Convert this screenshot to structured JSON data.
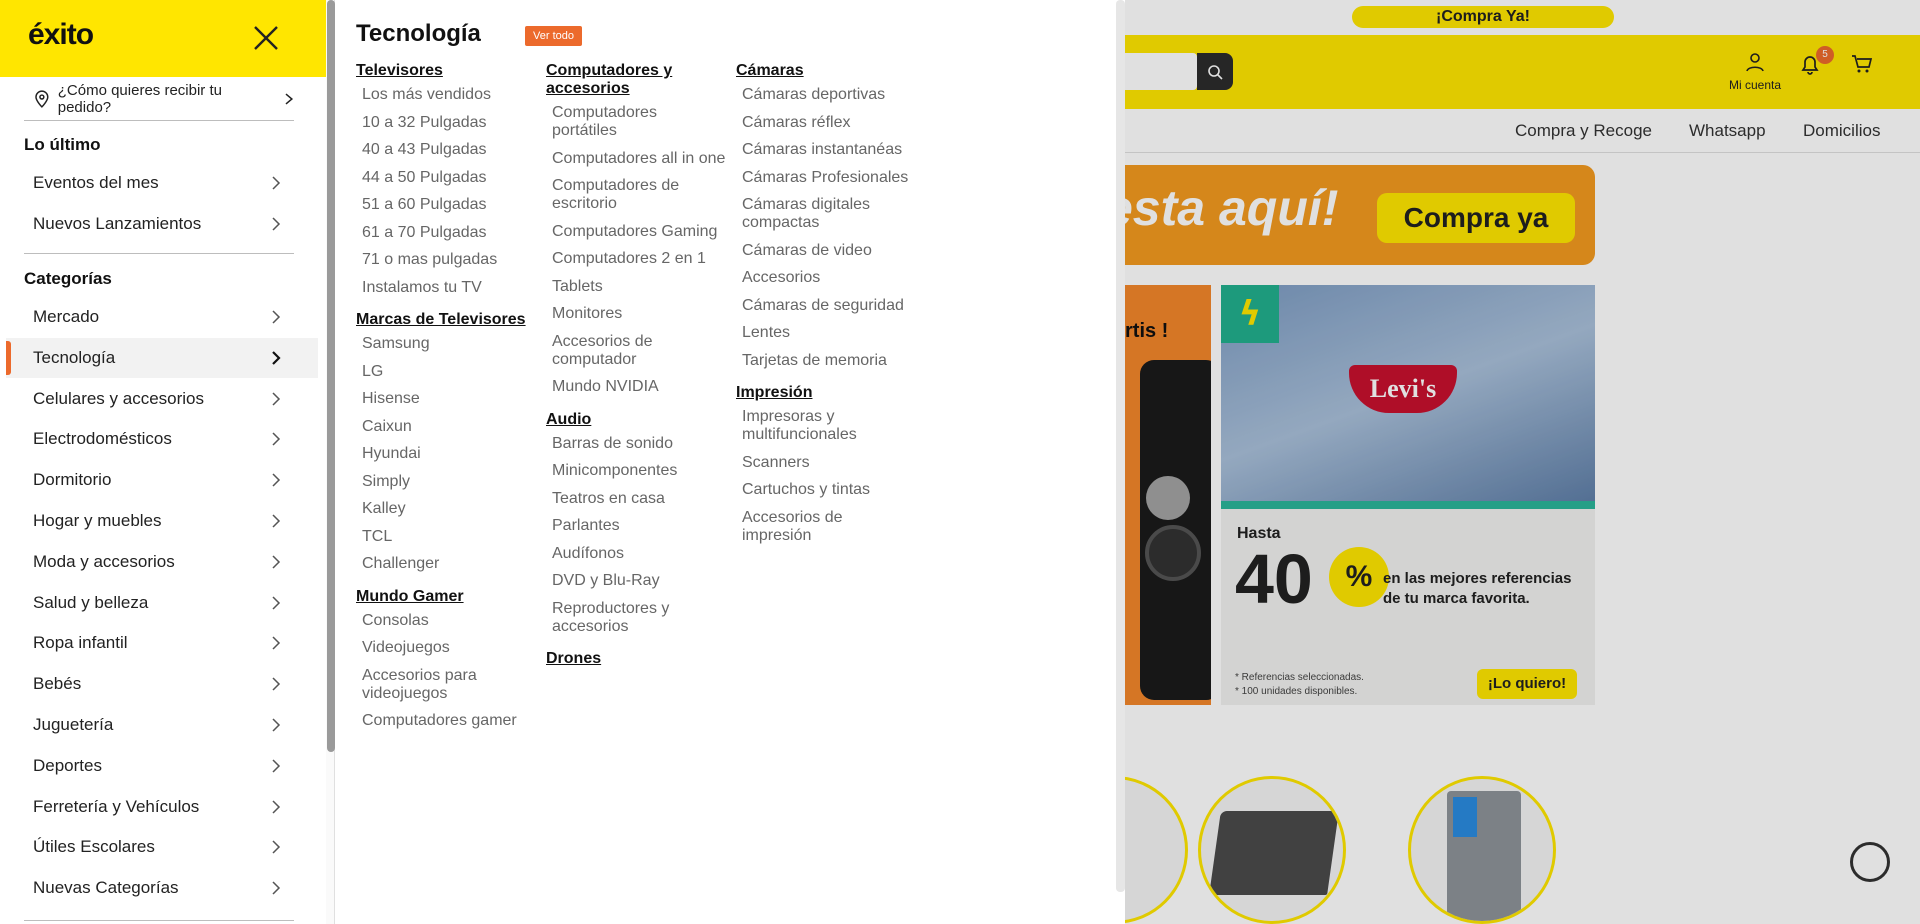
{
  "background": {
    "promo_pill": "¡Compra Ya!",
    "account_label": "Mi cuenta",
    "notif_count": "5",
    "subnav": [
      "Compra y Recoge",
      "Whatsapp",
      "Domicilios"
    ],
    "banner_text": "esta aquí!",
    "banner_button": "Compra ya",
    "phone_card_text": "rtis !",
    "levis_logo": "Levi's",
    "levis_hasta": "Hasta",
    "levis_number": "40",
    "levis_percent": "%",
    "levis_copy": "en las mejores referencias de tu marca favorita.",
    "levis_fine_1": "* Referencias seleccionadas.",
    "levis_fine_2": "* 100 unidades disponibles.",
    "levis_button": "¡Lo quiero!"
  },
  "sidebar": {
    "logo": "éxito",
    "delivery_prompt": "¿Cómo quieres recibir tu pedido?",
    "section_latest": "Lo último",
    "latest_items": [
      {
        "label": "Eventos del mes"
      },
      {
        "label": "Nuevos Lanzamientos"
      }
    ],
    "section_categories": "Categorías",
    "categories": [
      {
        "label": "Mercado"
      },
      {
        "label": "Tecnología",
        "active": true
      },
      {
        "label": "Celulares y accesorios"
      },
      {
        "label": "Electrodomésticos"
      },
      {
        "label": "Dormitorio"
      },
      {
        "label": "Hogar y muebles"
      },
      {
        "label": "Moda y accesorios"
      },
      {
        "label": "Salud y belleza"
      },
      {
        "label": "Ropa infantil"
      },
      {
        "label": "Bebés"
      },
      {
        "label": "Juguetería"
      },
      {
        "label": "Deportes"
      },
      {
        "label": "Ferretería y Vehículos"
      },
      {
        "label": "Útiles Escolares"
      },
      {
        "label": "Nuevas Categorías"
      }
    ]
  },
  "panel": {
    "title": "Tecnología",
    "ver_todo": "Ver todo",
    "columns": [
      [
        {
          "title": "Televisores",
          "links": [
            "Los más vendidos",
            "10 a 32 Pulgadas",
            "40 a 43 Pulgadas",
            "44 a 50 Pulgadas",
            "51 a 60 Pulgadas",
            "61 a 70 Pulgadas",
            "71 o mas pulgadas",
            "Instalamos tu TV"
          ]
        },
        {
          "title": "Marcas de Televisores",
          "links": [
            "Samsung",
            "LG",
            "Hisense",
            "Caixun",
            "Hyundai",
            "Simply",
            "Kalley",
            "TCL",
            "Challenger"
          ]
        },
        {
          "title": "Mundo Gamer",
          "links": [
            "Consolas",
            "Videojuegos",
            "Accesorios para videojuegos",
            "Computadores gamer"
          ]
        }
      ],
      [
        {
          "title": "Computadores y accesorios",
          "links": [
            "Computadores portátiles",
            "Computadores all in one",
            "Computadores de escritorio",
            "Computadores Gaming",
            "Computadores 2 en 1",
            "Tablets",
            "Monitores",
            "Accesorios de computador",
            "Mundo NVIDIA"
          ]
        },
        {
          "title": "Audio",
          "links": [
            "Barras de sonido",
            "Minicomponentes",
            "Teatros en casa",
            "Parlantes",
            "Audífonos",
            "DVD y Blu-Ray",
            "Reproductores y accesorios"
          ]
        },
        {
          "title": "Drones",
          "links": []
        }
      ],
      [
        {
          "title": "Cámaras",
          "links": [
            "Cámaras deportivas",
            "Cámaras réflex",
            "Cámaras instantanéas",
            "Cámaras Profesionales",
            "Cámaras digitales compactas",
            "Cámaras de video",
            "Accesorios",
            "Cámaras de seguridad",
            "Lentes",
            "Tarjetas de memoria"
          ]
        },
        {
          "title": "Impresión",
          "links": [
            "Impresoras y multifuncionales",
            "Scanners",
            "Cartuchos y tintas",
            "Accesorios de impresión"
          ]
        }
      ]
    ]
  }
}
